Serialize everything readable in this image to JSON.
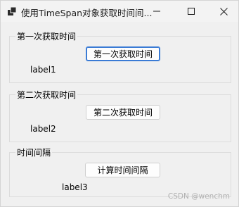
{
  "window": {
    "title": "使用TimeSpan对象获取时间间..."
  },
  "groups": [
    {
      "title": "第一次获取时间",
      "button": "第一次获取时间",
      "label": "label1"
    },
    {
      "title": "第二次获取时间",
      "button": "第二次获取时间",
      "label": "label2"
    },
    {
      "title": "时间间隔",
      "button": "计算时间间隔",
      "label": "label3"
    }
  ],
  "watermark": "CSDN @wenchm",
  "colors": {
    "accent": "#3a7bd5",
    "window_bg": "#f0f0f0",
    "border": "#dcdcdc"
  },
  "icons": [
    "app-icon",
    "minimize-icon",
    "maximize-icon",
    "close-icon"
  ]
}
